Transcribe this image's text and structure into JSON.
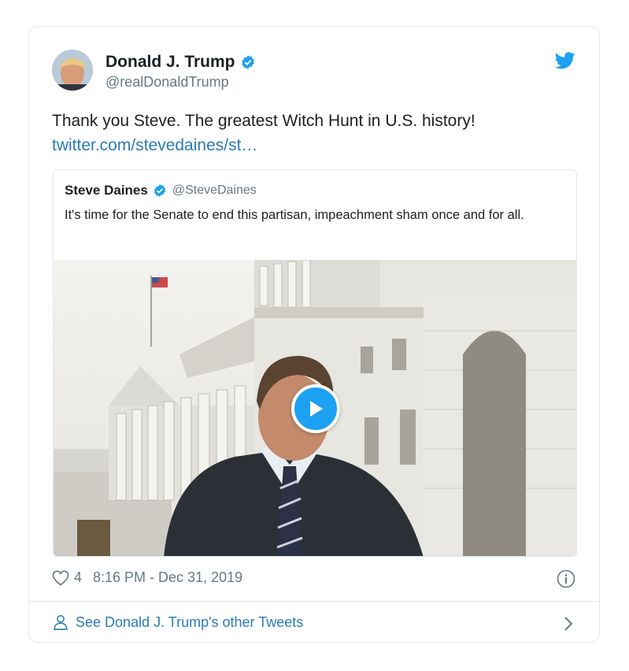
{
  "tweet": {
    "author_name": "Donald J. Trump",
    "author_handle": "@realDonaldTrump",
    "text": "Thank you Steve. The greatest Witch Hunt in U.S. history!",
    "link_text": "twitter.com/stevedaines/st…",
    "likes": "4",
    "timestamp": "8:16 PM - Dec 31, 2019"
  },
  "quoted": {
    "author_name": "Steve Daines",
    "author_handle": "@SteveDaines",
    "text": "It's time for the Senate to end this partisan, impeachment sham once and for all."
  },
  "footer": {
    "other_tweets_label": "See Donald J. Trump's other Tweets"
  },
  "colors": {
    "accent": "#1da1f2",
    "link": "#2b7bb9",
    "muted": "#697882",
    "border": "#e1e8ed"
  },
  "icons": [
    "verified-badge-icon",
    "twitter-bird-icon",
    "play-icon",
    "heart-icon",
    "info-icon",
    "person-icon",
    "chevron-right-icon"
  ]
}
